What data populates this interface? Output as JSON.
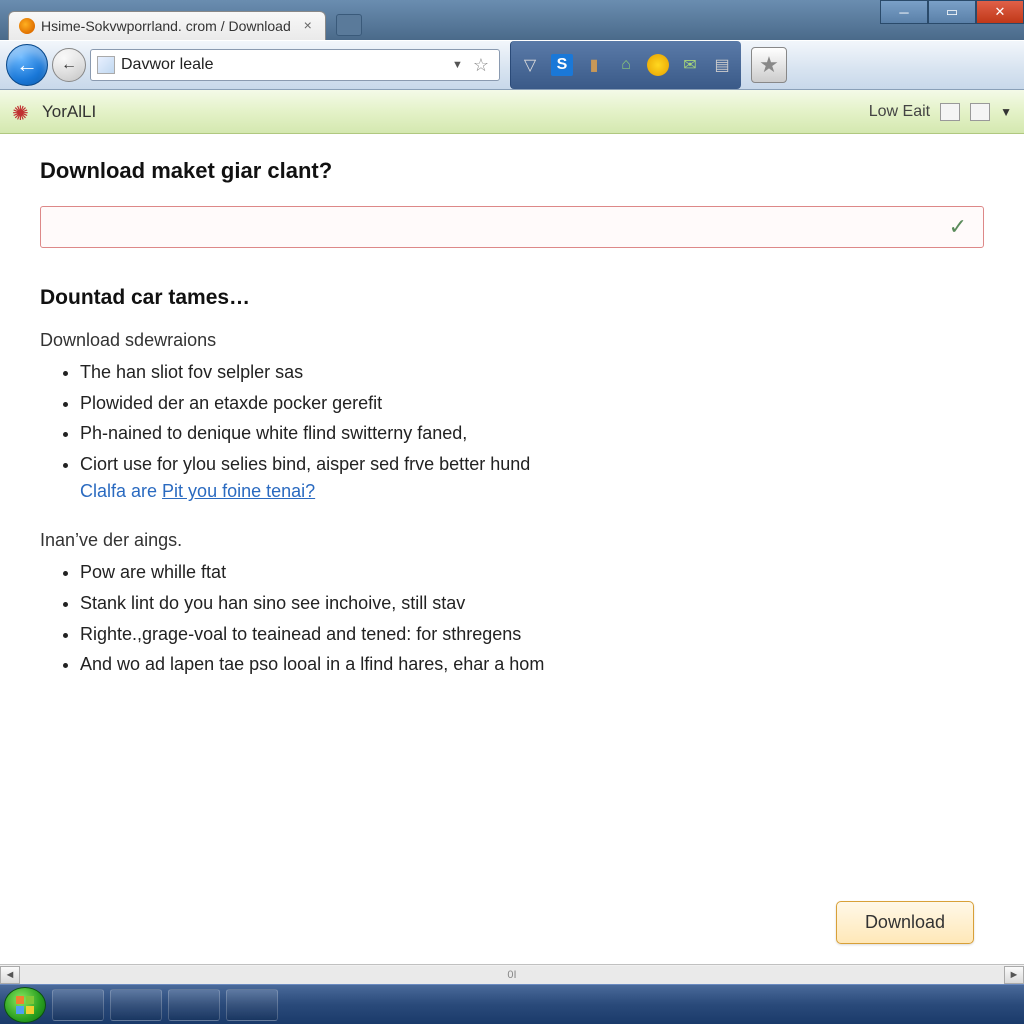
{
  "tab": {
    "title": "Hsime-Sokvwporrland. crom / Download"
  },
  "addressbar": {
    "value": "Davwor leale"
  },
  "appbar": {
    "title": "YorAlLI",
    "right_label": "Low Eait"
  },
  "page": {
    "heading": "Download maket giar clant?",
    "subheading": "Dountad car tames…",
    "section1": {
      "title": "Download sdewraions",
      "items": [
        "The han sliot fov selpler sas",
        "Plowided der an etaxde pocker gerefit",
        "Ph-nained to denique white flind switterny faned,",
        "Ciort use for ylou selies bind, aisper sed frve better hund"
      ],
      "link_prefix": "Clalfa are ",
      "link_text": "Pit you foine tenai?"
    },
    "section2": {
      "title": "Inan’ve der aings.",
      "items": [
        "Pow are whille ftat",
        "Stank lint do you han sino see inchoive, still stav",
        "Righte.,grage-voal to teainead and tened: for sthregens",
        "And wo ad lapen tae pso looal in a lfind hares, ehar a hom"
      ]
    },
    "download_button": "Download"
  },
  "scrollbar": {
    "track_label": "0I"
  }
}
